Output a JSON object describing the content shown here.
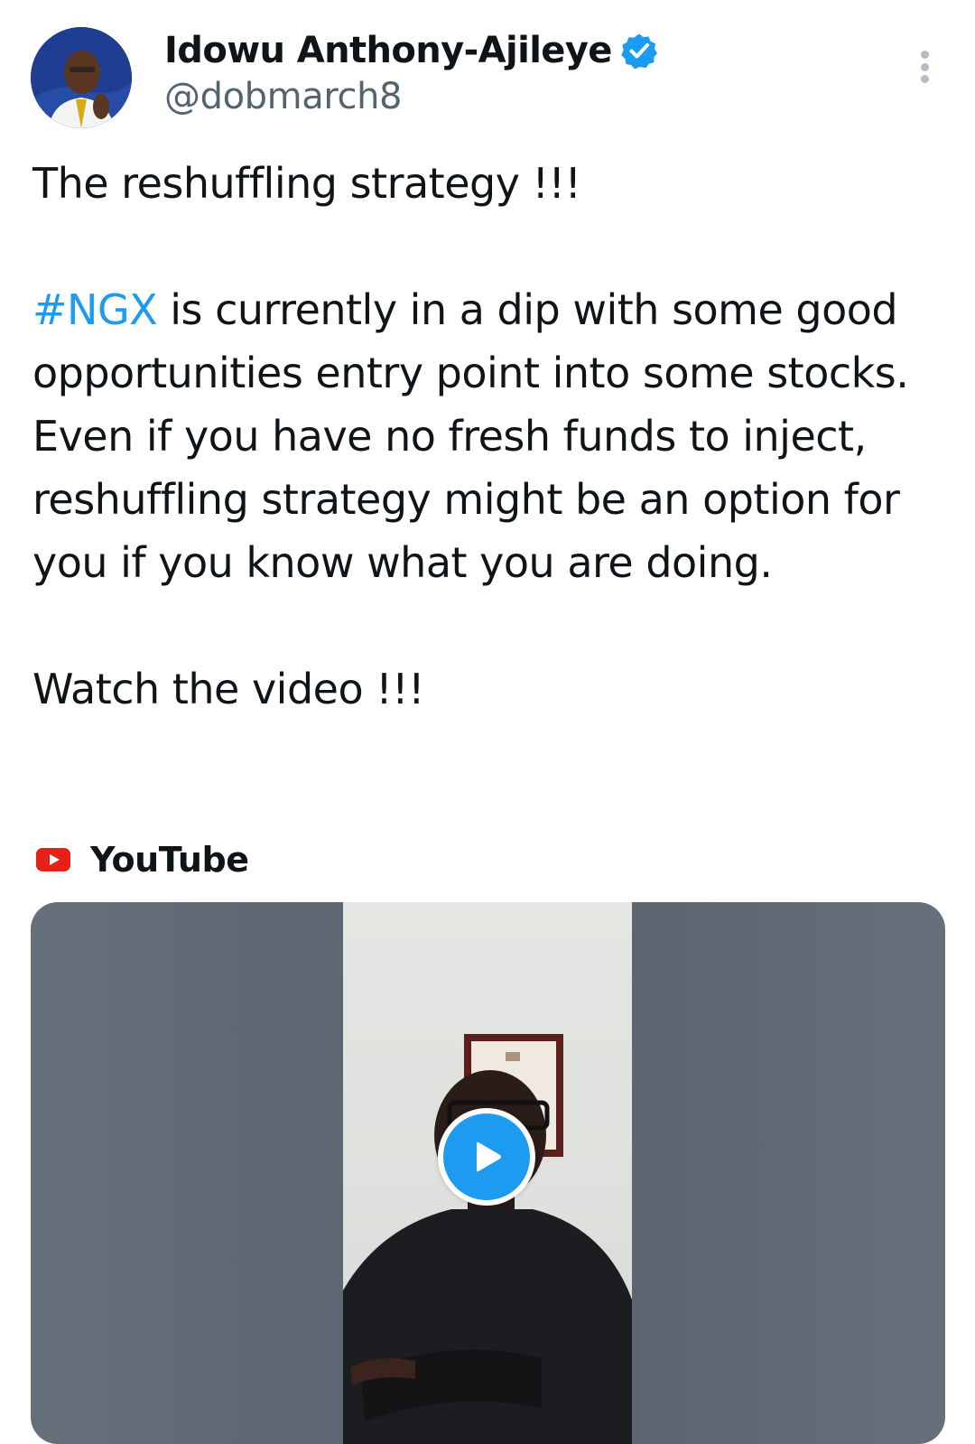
{
  "tweet": {
    "author": {
      "display_name": "Idowu Anthony-Ajileye",
      "handle": "@dobmarch8",
      "verified": true,
      "verified_icon": "verified-badge-icon",
      "avatar_icon": "profile-photo"
    },
    "more_icon": "more-vertical-icon",
    "text": {
      "line1": "The reshuffling strategy !!!",
      "hashtag": "#NGX",
      "paragraph2_rest": " is currently in a dip with some good opportunities entry point into some stocks. Even if you have no fresh funds to inject, reshuffling strategy might be an option for you if you know what you are doing.",
      "line3": "Watch the video !!!"
    },
    "link_card": {
      "source_icon": "youtube-icon",
      "source_label": "YouTube",
      "play_icon": "play-icon"
    }
  },
  "colors": {
    "text_primary": "#0f1419",
    "text_secondary": "#536471",
    "accent": "#1d9bf0",
    "youtube_red": "#e62117"
  }
}
